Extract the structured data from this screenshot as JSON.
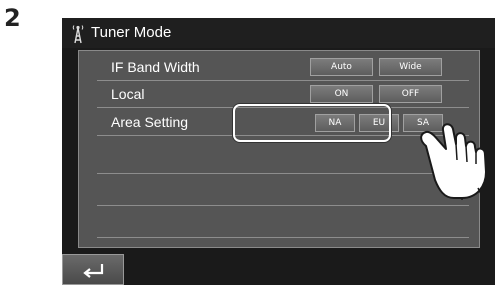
{
  "step": {
    "number": "2"
  },
  "screen": {
    "title": "Tuner Mode",
    "title_icon": "antenna-icon",
    "rows": [
      {
        "label": "IF Band Width",
        "options": [
          "Auto",
          "Wide"
        ]
      },
      {
        "label": "Local",
        "options": [
          "ON",
          "OFF"
        ]
      },
      {
        "label": "Area Setting",
        "options": [
          "NA",
          "EU",
          "SA"
        ],
        "highlighted": true
      }
    ],
    "back_icon": "back-arrow-icon",
    "pointer_icon": "hand-pointer-icon"
  },
  "colors": {
    "screen_bg": "#1a1a1a",
    "panel_bg": "#555555",
    "button_bg": "#6e6e6e",
    "text": "#ffffff"
  }
}
